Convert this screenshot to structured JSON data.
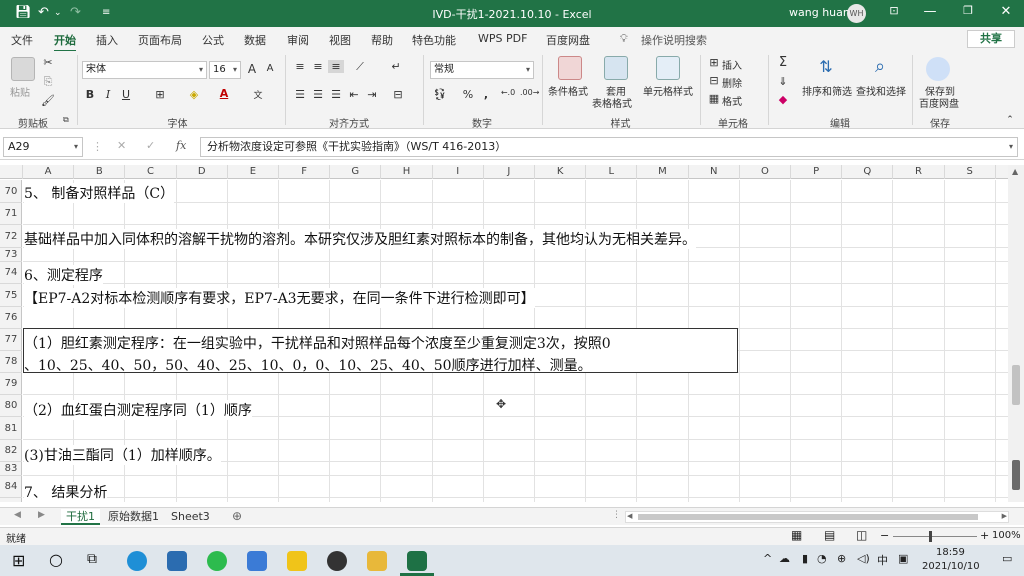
{
  "window": {
    "title": "IVD-干扰1-2021.10.10  -  Excel",
    "user": "wang huan",
    "avatar_initials": "WH"
  },
  "menu": {
    "tabs": [
      "文件",
      "开始",
      "插入",
      "页面布局",
      "公式",
      "数据",
      "审阅",
      "视图",
      "帮助",
      "特色功能",
      "WPS PDF",
      "百度网盘"
    ],
    "search_placeholder": "操作说明搜索",
    "share": "共享"
  },
  "ribbon": {
    "clipboard": {
      "paste": "粘贴",
      "label": "剪贴板"
    },
    "font": {
      "name": "宋体",
      "size": "16",
      "label": "字体",
      "bold": "B",
      "italic": "I",
      "underline": "U",
      "grow": "A",
      "shrink": "A"
    },
    "alignment": {
      "label": "对齐方式"
    },
    "number": {
      "format": "常规",
      "label": "数字",
      "percent": "%",
      "comma": ","
    },
    "styles": {
      "conditional": "条件格式",
      "table_line1": "套用",
      "table_line2": "表格格式",
      "cell": "单元格样式",
      "label": "样式"
    },
    "cells": {
      "insert": "插入",
      "delete": "删除",
      "format": "格式",
      "label": "单元格"
    },
    "editing": {
      "sum": "Σ",
      "sort": "排序和筛选",
      "find": "查找和选择",
      "label": "编辑"
    },
    "save": {
      "line1": "保存到",
      "line2": "百度网盘",
      "label": "保存"
    }
  },
  "formula_bar": {
    "name_box": "A29",
    "fx": "fx",
    "cancel": "✕",
    "enter": "✓",
    "content": "分析物浓度设定可参照《干扰实验指南》（WS/T 416-2013）"
  },
  "grid": {
    "columns": [
      "A",
      "B",
      "C",
      "D",
      "E",
      "F",
      "G",
      "H",
      "I",
      "J",
      "K",
      "L",
      "M",
      "N",
      "O",
      "P",
      "Q",
      "R",
      "S"
    ],
    "rows": [
      "70",
      "71",
      "72",
      "73",
      "74",
      "75",
      "76",
      "77",
      "78",
      "79",
      "80",
      "81",
      "82",
      "83",
      "84"
    ],
    "cells": {
      "r70": "5、 制备对照样品（C）",
      "r72": "基础样品中加入同体积的溶解干扰物的溶剂。本研究仅涉及胆红素对照标本的制备，其他均认为无相关差异。",
      "r74": "6、测定程序",
      "r75": "【EP7-A2对标本检测顺序有要求，EP7-A3无要求，在同一条件下进行检测即可】",
      "r77": "（1）胆红素测定程序：在一组实验中，干扰样品和对照样品每个浓度至少重复测定3次，按照0",
      "r78": "、10、25、40、50，50、40、25、10、0，0、10、25、40、50顺序进行加样、测量。",
      "r80": "（2）血红蛋白测定程序同（1）顺序",
      "r82": "(3)甘油三酯同（1）加样顺序。",
      "r84": "7、 结果分析"
    }
  },
  "sheets": [
    "干扰1",
    "原始数据1",
    "Sheet3"
  ],
  "status": {
    "ready": "就绪",
    "zoom": "100%"
  },
  "taskbar": {
    "time": "18:59",
    "date": "2021/10/10",
    "ime": "中"
  },
  "colors": {
    "excel_green": "#217346",
    "ribbon_bg": "#f3f3f3",
    "taskbar_bg": "#dfe6ec"
  }
}
